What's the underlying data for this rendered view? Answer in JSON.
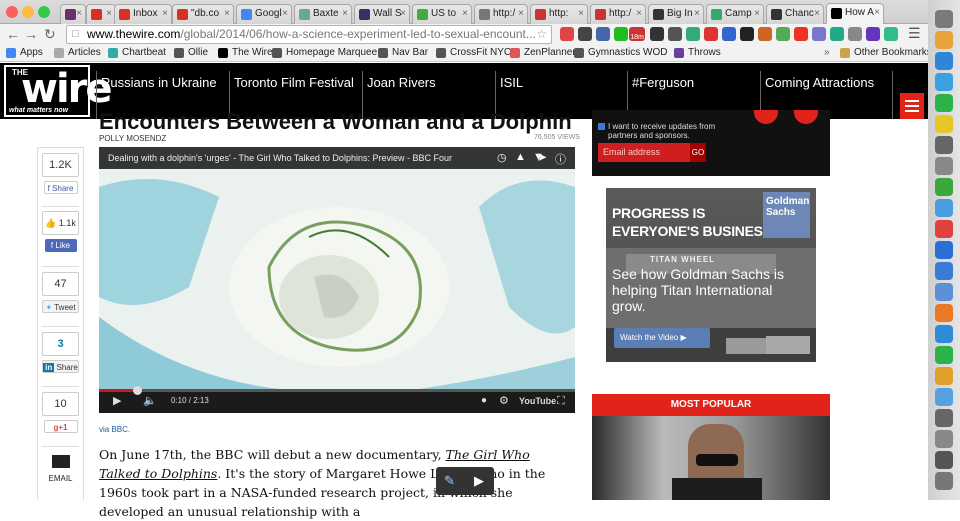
{
  "browser": {
    "tabs": [
      {
        "label": "",
        "color": "#6b2d6b",
        "icon": "tab-icon-purple"
      },
      {
        "label": "",
        "color": "#d93025",
        "icon": "gmail-icon"
      },
      {
        "label": "Inbox",
        "color": "#d93025",
        "icon": "gmail-icon"
      },
      {
        "label": "\"db.co",
        "color": "#d93025",
        "icon": "gmail-icon"
      },
      {
        "label": "Googl",
        "color": "#4285f4",
        "icon": "google-icon"
      },
      {
        "label": "Baxte",
        "color": "#6a8",
        "icon": "doc-icon"
      },
      {
        "label": "Wall S",
        "color": "#336",
        "icon": "wsj-icon"
      },
      {
        "label": "US to",
        "color": "#4a4",
        "icon": "page-icon"
      },
      {
        "label": "http:/",
        "color": "#777",
        "icon": "page-icon"
      },
      {
        "label": "http:",
        "color": "#c33",
        "icon": "page-icon"
      },
      {
        "label": "http:/",
        "color": "#c33",
        "icon": "page-icon"
      },
      {
        "label": "Big In",
        "color": "#333",
        "icon": "page-icon"
      },
      {
        "label": "Camp",
        "color": "#3a6",
        "icon": "page-icon"
      },
      {
        "label": "Chanc",
        "color": "#333",
        "icon": "page-icon"
      },
      {
        "label": "How A",
        "color": "#000",
        "icon": "wire-icon"
      }
    ],
    "url_domain": "www.thewire.com",
    "url_rest": "/global/2014/06/how-a-science-experiment-led-to-sexual-encount...",
    "badge": "18m",
    "bookmarks": [
      {
        "label": "Apps",
        "color": "#4285f4"
      },
      {
        "label": "Articles",
        "color": "#aaa"
      },
      {
        "label": "Chartbeat",
        "color": "#3aa"
      },
      {
        "label": "Ollie",
        "color": "#555"
      },
      {
        "label": "The Wire",
        "color": "#000"
      },
      {
        "label": "Homepage Marquee",
        "color": "#555"
      },
      {
        "label": "Nav Bar",
        "color": "#555"
      },
      {
        "label": "CrossFit NYC",
        "color": "#555"
      },
      {
        "label": "ZenPlanner",
        "color": "#d55"
      },
      {
        "label": "Gymnastics WOD",
        "color": "#555"
      },
      {
        "label": "Throws",
        "color": "#6a3fa0"
      }
    ],
    "bookmarks_more": "»",
    "other_bookmarks": "Other Bookmarks"
  },
  "site": {
    "logo_the": "THE",
    "logo_word": "wire",
    "logo_tagline": "what matters now",
    "nav": [
      "Russians in Ukraine",
      "Toronto Film Festival",
      "Joan Rivers",
      "ISIL",
      "#Ferguson",
      "Coming Attractions"
    ]
  },
  "article": {
    "headline": "Encounters Between a Woman and a Dolphin",
    "author": "POLLY MOSENDZ",
    "views": "76,505 VIEWS",
    "video_title": "Dealing with a dolphin's 'urges' - The Girl Who Talked to Dolphins: Preview - BBC Four",
    "video_time": "0:10 / 2:13",
    "video_progress": 0.08,
    "via": "via BBC.",
    "body_1": "On June 17th, the BBC will debut a new documentary, ",
    "body_title": "The Girl Who Talked to Dolphins",
    "body_2": ". It's the story of Margaret Howe Lovatt, who in the 1960s took part in a NASA-funded research project, in which she developed an unusual relationship with a"
  },
  "share": {
    "facebook_count": "1.2K",
    "facebook_label": "Share",
    "like_count": "1.1k",
    "like_label": "Like",
    "tweet_count": "47",
    "tweet_label": "Tweet",
    "linkedin_count": "3",
    "linkedin_label": "Share",
    "gplus_count": "10",
    "gplus_label": "+1",
    "email_label": "EMAIL"
  },
  "sidebar": {
    "newsletter_text": "I want to receive updates from partners and sponsors.",
    "email_placeholder": "Email address",
    "go_label": "GO",
    "ad_headline": "PROGRESS IS EVERYONE'S BUSINESS",
    "ad_logo": "Goldman Sachs",
    "ad_sign": "TITAN WHEEL",
    "ad_body": "See how Goldman Sachs is helping Titan International grow.",
    "ad_cta": "Watch the Video",
    "most_popular": "MOST POPULAR"
  },
  "dock_colors": [
    "#7a7a7a",
    "#e8a23b",
    "#2f86d6",
    "#3aa0e0",
    "#2bb34a",
    "#e6c52a",
    "#666",
    "#888",
    "#3aa83a",
    "#4a9ee0",
    "#e04040",
    "#2b6fd6",
    "#3a7bd5",
    "#5c8fd6",
    "#e97a23",
    "#2f8bd6",
    "#2bb34a",
    "#e0a02a",
    "#56a0e0",
    "#666",
    "#888",
    "#555",
    "#777"
  ]
}
